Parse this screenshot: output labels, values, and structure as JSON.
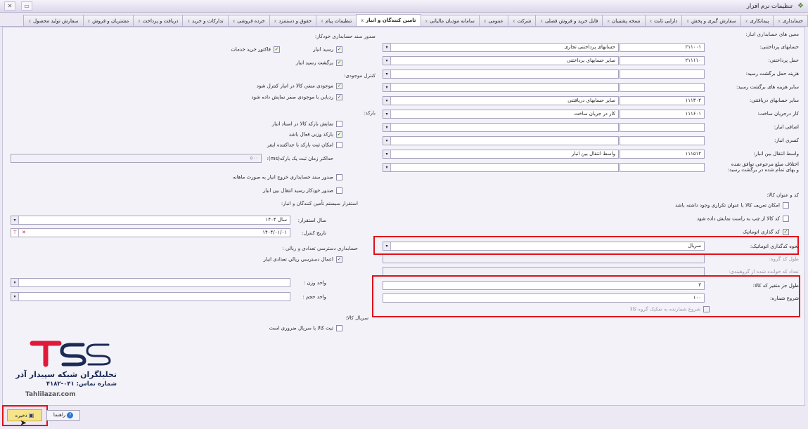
{
  "window": {
    "title": "تنظیمات نرم افزار",
    "min_label": "▭",
    "close_label": "✕"
  },
  "tabs": [
    {
      "label": "حسابداری"
    },
    {
      "label": "پیمانکاری"
    },
    {
      "label": "سفارش گیری و پخش"
    },
    {
      "label": "دارایی ثابت"
    },
    {
      "label": "نسخه پشتیبان"
    },
    {
      "label": "فایل خرید و فروش فصلی"
    },
    {
      "label": "شرکت"
    },
    {
      "label": "عمومی"
    },
    {
      "label": "سامانه مودیان مالیاتی"
    },
    {
      "label": "تامین کنندگان و انبار",
      "active": true
    },
    {
      "label": "تنظیمات پیام"
    },
    {
      "label": "حقوق و دستمزد"
    },
    {
      "label": "خرده فروشی"
    },
    {
      "label": "تدارکات و خرید"
    },
    {
      "label": "دریافت و پرداخت"
    },
    {
      "label": "مشتریان و فروش"
    },
    {
      "label": "سفارش تولید محصول"
    }
  ],
  "tab_close_glyph": "x",
  "right": {
    "section_title": "معین های حسابداری انبار:",
    "rows": [
      {
        "label": "حسابهای پرداختنی:",
        "code": "۲۱۱۰۰۱",
        "name": "حسابهای پرداختنی تجاری"
      },
      {
        "label": "حمل پرداختنی:",
        "code": "۲۱۱۱۱۰",
        "name": "سایر حسابهای پرداختنی"
      },
      {
        "label": "هزینه حمل برگشت رسید:",
        "code": "",
        "name": ""
      },
      {
        "label": "سایر هزینه های برگشت رسید:",
        "code": "",
        "name": ""
      },
      {
        "label": "سایر حسابهای دریافتنی:",
        "code": "۱۱۱۳۰۲",
        "name": "سایر حسابهای دریافتنی"
      },
      {
        "label": "کار درجریان ساخت:",
        "code": "۱۱۱۶۰۱",
        "name": "کار در جریان ساخت"
      },
      {
        "label": "اضافی انبار:",
        "code": "",
        "name": ""
      },
      {
        "label": "کسری انبار:",
        "code": "",
        "name": ""
      },
      {
        "label": "واسط انتقال بین انبار:",
        "code": "۱۱۱۵۱۲",
        "name": "واسط انتقال بین انبار"
      },
      {
        "label": "اختلاف مبلغ مرجوعی توافق شده",
        "label2": "و بهای تمام شده در برگشت رسید:",
        "code": "",
        "name": ""
      }
    ],
    "code_section_title": "کد و عنوان کالا:",
    "checks": [
      {
        "label": "امکان تعریف کالا با عنوان تکراری وجود داشته باشد",
        "checked": false
      },
      {
        "label": "کد کالا از چپ به راست نمایش داده شود",
        "checked": false
      },
      {
        "label": "کد گذاری اتوماتیک",
        "checked": true
      }
    ],
    "auto_code_label": "نحوه کدگذاری اتوماتیک:",
    "auto_code_value": "سریال",
    "group_code_len_label": "طول کد گروه:",
    "group_digits_label": "تعداد کد خوانده شده از گروهبندی:",
    "var_len_label": "طول جز متغیر کد کالا:",
    "var_len_value": "۳",
    "start_label": "شروع شماره:",
    "start_value": "۱۰۰",
    "start_by_group_label": "شروع شمارنده به تفکیک گروه کالا"
  },
  "left": {
    "auto_doc_title": "صدور سند حسابداری خودکار:",
    "auto_doc_checks": [
      {
        "label": "رسید انبار",
        "checked": true
      },
      {
        "label": "فاکتور خرید خدمات",
        "checked": true
      },
      {
        "label": "برگشت رسید انبار",
        "checked": true
      }
    ],
    "inv_title": "کنترل موجودی:",
    "inv_checks": [
      {
        "label": "موجودی منفی کالا در انبار کنترل شود",
        "checked": true
      },
      {
        "label": "ردیابی با موجودی صفر نمایش داده شود",
        "checked": true
      }
    ],
    "barcode_title": "بارکد:",
    "barcode_checks": [
      {
        "label": "نمایش بارکد کالا در اسناد انبار",
        "checked": false
      },
      {
        "label": "بارکد وزنی فعال باشد",
        "checked": true
      },
      {
        "label": "امکان ثبت بارکد با جداکننده اینتر",
        "checked": false
      }
    ],
    "barcode_time_label": "حداکثر زمان ثبت یک بارکد(ms):",
    "barcode_time_value": "۵۰۰",
    "extra_checks": [
      {
        "label": "صدور سند حسابداری خروج انبار به صورت ماهانه",
        "checked": false
      },
      {
        "label": "صدور خودکار رسید انتقال بین انبار",
        "checked": false
      }
    ],
    "deploy_title": "استقرار سیستم تأمین کنندگان و انبار:",
    "year_label": "سال استقرار:",
    "year_value": "سال ۱۴۰۴",
    "date_label": "تاریخ کنترل:",
    "date_value": "۱۴۰۴/۰۱/۰۱",
    "access_title": "حسابداری دسترسی تعدادی و ریالی :",
    "access_check": {
      "label": "اعمال دسترسی ریالی تعدادی انبار",
      "checked": true
    },
    "weight_label": "واحد وزن :",
    "volume_label": "واحد حجم :",
    "serial_title": "سریال کالا:",
    "serial_check": {
      "label": "ثبت کالا با سریال ضروری است",
      "checked": false
    }
  },
  "footer": {
    "save_label": "ذخیره",
    "help_label": "راهنما"
  },
  "logo": {
    "mark": "TSS",
    "company": "تحلیلگران شبکه سپیدار آذر",
    "phone": "شماره تماس: ۰۴۱-۴۱۸۲",
    "site": "Tahlilazar.com"
  },
  "colors": {
    "accent": "#e0101a",
    "brand_red": "#e0193a",
    "brand_navy": "#1c2a55"
  }
}
